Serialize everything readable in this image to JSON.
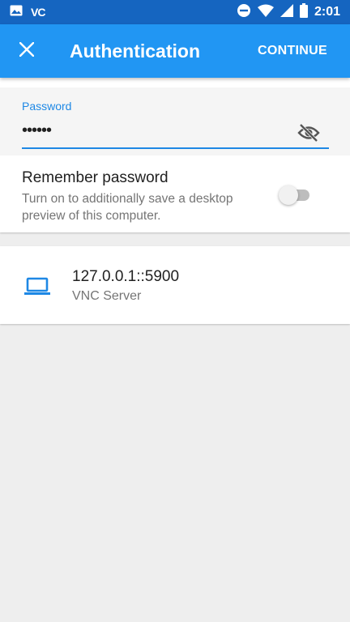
{
  "status_bar": {
    "carrier_text": "VC",
    "time": "2:01",
    "icons": [
      "image-icon",
      "dnd-icon",
      "wifi-icon",
      "signal-icon",
      "battery-icon"
    ]
  },
  "app_bar": {
    "title": "Authentication",
    "action_label": "CONTINUE",
    "close_icon": "close-icon"
  },
  "password": {
    "label": "Password",
    "masked_value": "••••••",
    "visibility_icon": "eye-off-icon"
  },
  "remember": {
    "title": "Remember password",
    "subtitle": "Turn on to additionally save a desktop preview of this computer.",
    "enabled": false
  },
  "server": {
    "address": "127.0.0.1::5900",
    "type": "VNC Server",
    "icon": "laptop-icon"
  },
  "colors": {
    "status_bar": "#1565c0",
    "app_bar": "#2196f3",
    "accent": "#1e88e5",
    "background": "#eeeeee"
  }
}
